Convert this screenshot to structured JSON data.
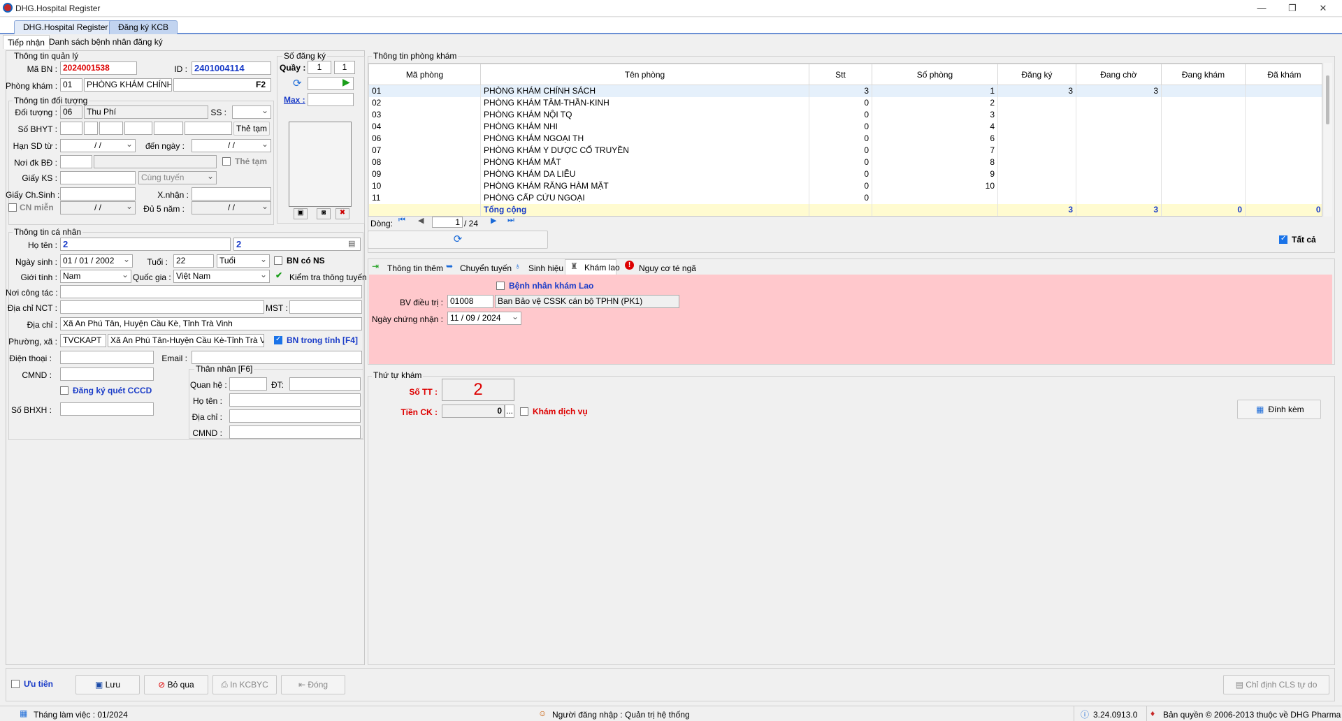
{
  "window": {
    "title": "DHG.Hospital Register",
    "min": "—",
    "max": "❐",
    "close": "✕"
  },
  "doc_tabs": [
    "DHG.Hospital Register",
    "Đăng ký KCB"
  ],
  "sub_tabs": [
    "Tiếp nhận",
    "Danh sách bệnh nhân đăng ký"
  ],
  "quanly": {
    "title": "Thông tin quản lý",
    "ma_bn_label": "Mã BN :",
    "ma_bn": "2024001538",
    "id_label": "ID :",
    "id": "2401004114",
    "phong_kham_label": "Phòng khám :",
    "phong_kham_code": "01",
    "phong_kham_name": "PHÒNG KHÁM CHÍNH S",
    "f2": "F2"
  },
  "sodangky": {
    "title": "Số đăng ký",
    "quay_label": "Quầy :",
    "quay1": "1",
    "quay2": "1",
    "max_label": "Max :"
  },
  "doituong": {
    "title": "Thông tin đối tượng",
    "doi_tuong_label": "Đối tượng :",
    "doi_tuong_code": "06",
    "doi_tuong_name": "Thu Phí",
    "ss_label": "SS :",
    "so_bhyt_label": "Số BHYT :",
    "the_tam_btn": "Thẻ tạm",
    "han_sd_label": "Hạn SD từ :",
    "date_blank": "/ /",
    "den_ngay_label": "đến ngày :",
    "noi_dk_label": "Nơi đk BĐ :",
    "the_tam_chk": "Thẻ tạm",
    "giay_ks_label": "Giấy KS :",
    "cung_tuyen": "Cùng tuyến",
    "giay_chsinh_label": "Giấy Ch.Sinh :",
    "xnhan_label": "X.nhận :",
    "cn_mien": "CN miễn",
    "du5nam_label": "Đủ 5 năm :"
  },
  "canhan": {
    "title": "Thông tin cá nhân",
    "ho_ten_label": "Họ tên :",
    "ho_ten": "2",
    "ho_ten2": "2",
    "ngay_sinh_label": "Ngày sinh :",
    "ngay_sinh": "01 / 01 / 2002",
    "tuoi_label": "Tuổi :",
    "tuoi": "22",
    "tuoi_unit": "Tuổi",
    "bn_co_ns": "BN có NS",
    "gioi_tinh_label": "Giới tính :",
    "gioi_tinh": "Nam",
    "quoc_gia_label": "Quốc gia :",
    "quoc_gia": "Việt Nam",
    "kiem_tra": "Kiểm tra thông tuyến",
    "noi_cong_tac_label": "Nơi công tác :",
    "dia_chi_nct_label": "Địa chỉ NCT :",
    "mst_label": "MST :",
    "dia_chi_label": "Địa chỉ :",
    "dia_chi": "Xã An Phú Tân, Huyện Cầu Kè, Tỉnh Trà Vinh",
    "phuong_xa_label": "Phường, xã :",
    "phuong_xa_code": "TVCKAPT",
    "phuong_xa_name": "Xã An Phú Tân-Huyện Cầu Kè-Tỉnh Trà Vinh",
    "bn_trong_tinh": "BN trong tỉnh [F4]",
    "dien_thoai_label": "Điện thoại :",
    "email_label": "Email :",
    "cmnd_label": "CMND :",
    "dk_quet": "Đăng ký quét CCCD",
    "so_bhxh_label": "Số BHXH :"
  },
  "thannhan": {
    "title": "Thân nhân [F6]",
    "quan_he_label": "Quan hệ :",
    "dt_label": "ĐT:",
    "ho_ten_label": "Họ tên :",
    "dia_chi_label": "Địa chỉ :",
    "cmnd_label": "CMND :"
  },
  "phongkham": {
    "title": "Thông tin phòng khám",
    "columns": [
      "Mã phòng",
      "Tên phòng",
      "Stt",
      "Số phòng",
      "Đăng ký",
      "Đang chờ",
      "Đang khám",
      "Đã khám"
    ],
    "rows": [
      [
        "01",
        "PHÒNG KHÁM CHÍNH SÁCH",
        "3",
        "1",
        "3",
        "3",
        "",
        ""
      ],
      [
        "02",
        "PHÒNG KHÁM TÂM-THẦN-KINH",
        "0",
        "2",
        "",
        "",
        "",
        ""
      ],
      [
        "03",
        "PHÒNG KHÁM NỘI TQ",
        "0",
        "3",
        "",
        "",
        "",
        ""
      ],
      [
        "04",
        "PHÒNG KHÁM NHI",
        "0",
        "4",
        "",
        "",
        "",
        ""
      ],
      [
        "06",
        "PHÒNG KHÁM NGOẠI TH",
        "0",
        "6",
        "",
        "",
        "",
        ""
      ],
      [
        "07",
        "PHÒNG KHÁM Y DƯỢC CỔ TRUYỀN",
        "0",
        "7",
        "",
        "",
        "",
        ""
      ],
      [
        "08",
        "PHÒNG KHÁM MẮT",
        "0",
        "8",
        "",
        "",
        "",
        ""
      ],
      [
        "09",
        "PHÒNG KHÁM DA LIỄU",
        "0",
        "9",
        "",
        "",
        "",
        ""
      ],
      [
        "10",
        "PHÒNG KHÁM RĂNG HÀM MẶT",
        "0",
        "10",
        "",
        "",
        "",
        ""
      ],
      [
        "11",
        "PHÒNG CẤP CỨU NGOẠI",
        "0",
        "",
        "",
        "",
        "",
        ""
      ]
    ],
    "total": [
      "",
      "Tổng cộng",
      "",
      "",
      "3",
      "3",
      "0",
      "0"
    ],
    "dong_label": "Dòng:",
    "page": "1",
    "pages": "/ 24",
    "tat_ca": "Tất cả"
  },
  "info_tabs": [
    "Thông tin thêm",
    "Chuyển tuyến",
    "Sinh hiệu",
    "Khám lao",
    "Nguy cơ té ngã"
  ],
  "khamlao": {
    "bn_kham_lao": "Bệnh nhân khám Lao",
    "bv_dieu_tri_label": "BV điều trị :",
    "bv_code": "01008",
    "bv_name": "Ban Bảo vệ CSSK cán bộ TPHN (PK1)",
    "ngay_cn_label": "Ngày chứng nhận :",
    "ngay_cn": "11 / 09 / 2024"
  },
  "thutu": {
    "title": "Thứ tự khám",
    "so_tt_label": "Số TT :",
    "so_tt": "2",
    "tien_ck_label": "Tiền CK :",
    "tien_ck": "0",
    "ellipsis": "...",
    "kham_dv": "Khám dịch vụ",
    "dinh_kem": "Đính kèm"
  },
  "bottom": {
    "uu_tien": "Ưu tiên",
    "luu": "Lưu",
    "bo_qua": "Bỏ qua",
    "in": "In KCBYC",
    "dong": "Đóng",
    "chi_dinh": "Chỉ định CLS tự do"
  },
  "status": {
    "thang": "Tháng làm việc : 01/2024",
    "user": "Người đăng nhập : Quản trị hệ thống",
    "version": "3.24.0913.0",
    "copyright": "Bản quyền © 2006-2013 thuộc về DHG Pharma"
  }
}
